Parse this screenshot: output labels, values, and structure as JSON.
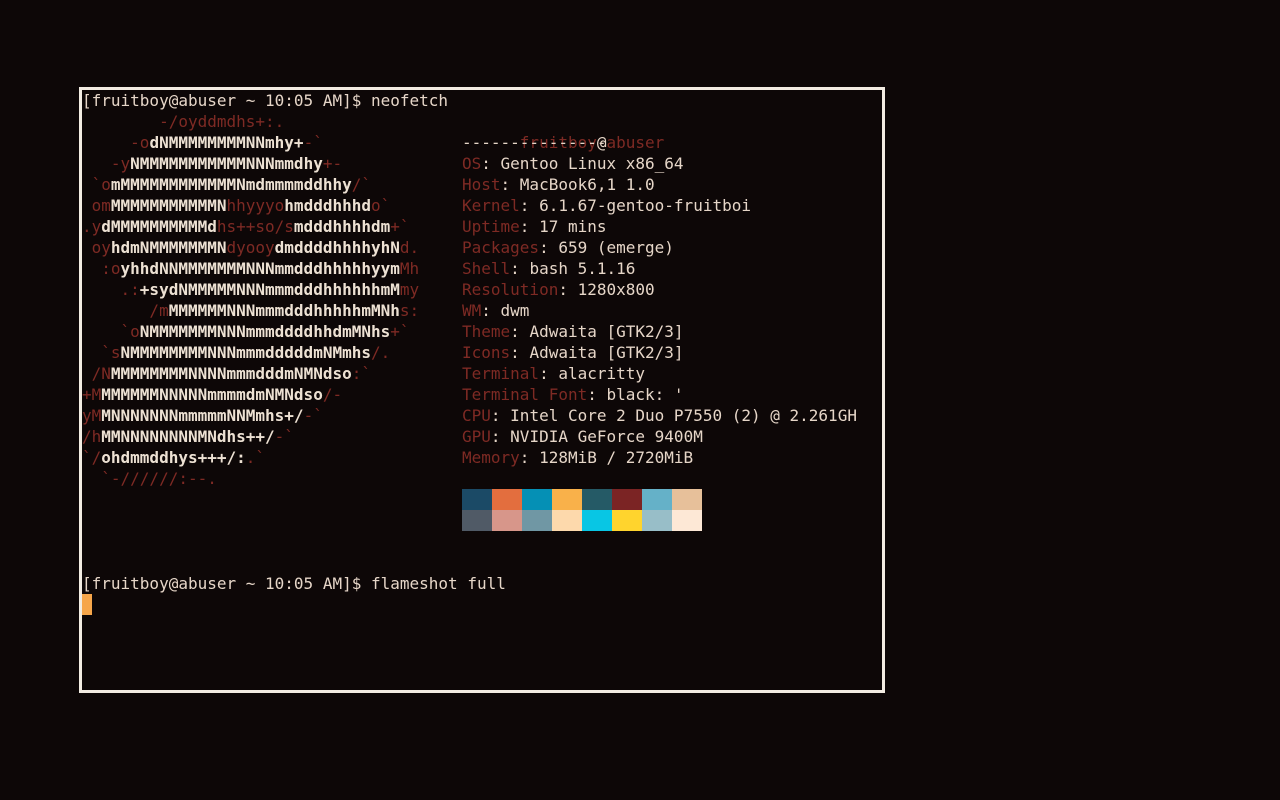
{
  "terminal": {
    "prompt1": "[fruitboy@abuser ~ 10:05 AM]$ neofetch",
    "prompt2": "[fruitboy@abuser ~ 10:05 AM]$ flameshot full"
  },
  "logo": [
    [
      [
        "r",
        "        -/oyddmdhs+:."
      ]
    ],
    [
      [
        "r",
        "     -o"
      ],
      [
        "b",
        "dNMMMMMMMMNNmhy+"
      ],
      [
        "r",
        "-`"
      ]
    ],
    [
      [
        "r",
        "   -y"
      ],
      [
        "b",
        "NMMMMMMMMMMMNNNmmdhy"
      ],
      [
        "r",
        "+-"
      ]
    ],
    [
      [
        "r",
        " `o"
      ],
      [
        "b",
        "mMMMMMMMMMMMMNmdmmmmddhhy"
      ],
      [
        "r",
        "/`"
      ]
    ],
    [
      [
        "r",
        " om"
      ],
      [
        "b",
        "MMMMMMMMMMMN"
      ],
      [
        "r",
        "hhyyyo"
      ],
      [
        "b",
        "hmdddhhhd"
      ],
      [
        "r",
        "o`"
      ]
    ],
    [
      [
        "r",
        ".y"
      ],
      [
        "b",
        "dMMMMMMMMMMd"
      ],
      [
        "r",
        "hs++so/s"
      ],
      [
        "b",
        "mdddhhhhdm"
      ],
      [
        "r",
        "+`"
      ]
    ],
    [
      [
        "r",
        " oy"
      ],
      [
        "b",
        "hdmNMMMMMMMN"
      ],
      [
        "r",
        "dyooy"
      ],
      [
        "b",
        "dmddddhhhhyhN"
      ],
      [
        "r",
        "d."
      ]
    ],
    [
      [
        "r",
        "  :o"
      ],
      [
        "b",
        "yhhdNNMMMMMMMNNNmmdddhhhhhyym"
      ],
      [
        "r",
        "Mh"
      ]
    ],
    [
      [
        "r",
        "    .:"
      ],
      [
        "b",
        "+sydNMMMMMNNNmmmdddhhhhhhmM"
      ],
      [
        "r",
        "my"
      ]
    ],
    [
      [
        "r",
        "       /m"
      ],
      [
        "b",
        "MMMMMMNNNmmmdddhhhhhmMNh"
      ],
      [
        "r",
        "s:"
      ]
    ],
    [
      [
        "r",
        "    `o"
      ],
      [
        "b",
        "NMMMMMMMNNNmmmddddhhdmMNhs"
      ],
      [
        "r",
        "+`"
      ]
    ],
    [
      [
        "r",
        "  `s"
      ],
      [
        "b",
        "NMMMMMMMMNNNmmmdddddmNMmhs"
      ],
      [
        "r",
        "/."
      ]
    ],
    [
      [
        "r",
        " /N"
      ],
      [
        "b",
        "MMMMMMMMNNNNmmmdddmNMNdso"
      ],
      [
        "r",
        ":`"
      ]
    ],
    [
      [
        "r",
        "+M"
      ],
      [
        "b",
        "MMMMMMNNNNNmmmmdmNMNdso"
      ],
      [
        "r",
        "/-"
      ]
    ],
    [
      [
        "r",
        "yM"
      ],
      [
        "b",
        "MNNNNNNNmmmmmNNMmhs+/"
      ],
      [
        "r",
        "-`"
      ]
    ],
    [
      [
        "r",
        "/h"
      ],
      [
        "b",
        "MMNNNNNNNNMNdhs++/"
      ],
      [
        "r",
        "-`"
      ]
    ],
    [
      [
        "r",
        "`/"
      ],
      [
        "b",
        "ohdmmddhys+++/:"
      ],
      [
        "r",
        ".`"
      ]
    ],
    [
      [
        "r",
        "  `-//////:--."
      ]
    ]
  ],
  "sysinfo": {
    "user": "fruitboy",
    "at": "@",
    "host": "abuser",
    "underline": "---------------",
    "fields": [
      {
        "key": "OS",
        "value": "Gentoo Linux x86_64"
      },
      {
        "key": "Host",
        "value": "MacBook6,1 1.0"
      },
      {
        "key": "Kernel",
        "value": "6.1.67-gentoo-fruitboi"
      },
      {
        "key": "Uptime",
        "value": "17 mins"
      },
      {
        "key": "Packages",
        "value": "659 (emerge)"
      },
      {
        "key": "Shell",
        "value": "bash 5.1.16"
      },
      {
        "key": "Resolution",
        "value": "1280x800"
      },
      {
        "key": "WM",
        "value": "dwm"
      },
      {
        "key": "Theme",
        "value": "Adwaita [GTK2/3]"
      },
      {
        "key": "Icons",
        "value": "Adwaita [GTK2/3]"
      },
      {
        "key": "Terminal",
        "value": "alacritty"
      },
      {
        "key": "Terminal Font",
        "value": "black: '"
      },
      {
        "key": "CPU",
        "value": "Intel Core 2 Duo P7550 (2) @ 2.261GH"
      },
      {
        "key": "GPU",
        "value": "NVIDIA GeForce 9400M"
      },
      {
        "key": "Memory",
        "value": "128MiB / 2720MiB"
      }
    ]
  },
  "palette": [
    "#1b4a66",
    "#e36e3e",
    "#0590b5",
    "#f9b14a",
    "#255a66",
    "#7b2424",
    "#65b1c8",
    "#e7c09a",
    "#505a66",
    "#d7968a",
    "#7097a4",
    "#fdd9ac",
    "#08c6e4",
    "#ffd42d",
    "#98bec8",
    "#fde8d6"
  ],
  "colors": {
    "background": "#0d0707",
    "border": "#f2ece2",
    "accent": "#7e2a24",
    "text": "#e6d6c8",
    "cursor": "#f6a64a"
  }
}
